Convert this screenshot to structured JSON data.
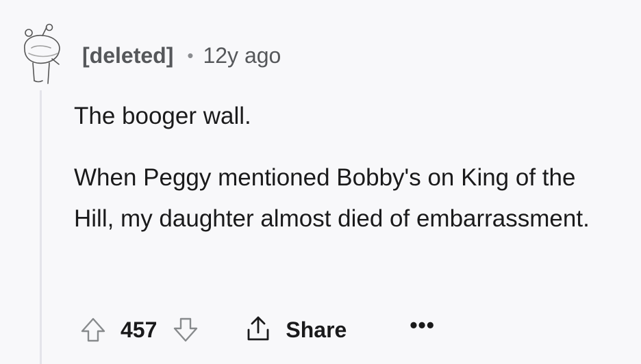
{
  "comment": {
    "author": "[deleted]",
    "separator": "•",
    "age": "12y ago",
    "body": [
      "The booger wall.",
      "When Peggy mentioned Bobby's on King of the Hill, my daughter almost died of embarrassment."
    ]
  },
  "actions": {
    "score": "457",
    "share_label": "Share",
    "more_label": "•••",
    "upvote_icon": "upvote-arrow-icon",
    "downvote_icon": "downvote-arrow-icon",
    "share_icon": "share-icon"
  },
  "colors": {
    "background": "#f8f8fa",
    "text": "#1a1a1b",
    "meta_text": "#55575a",
    "thread_line": "#e4e4ea",
    "icon_stroke": "#878a8c"
  }
}
